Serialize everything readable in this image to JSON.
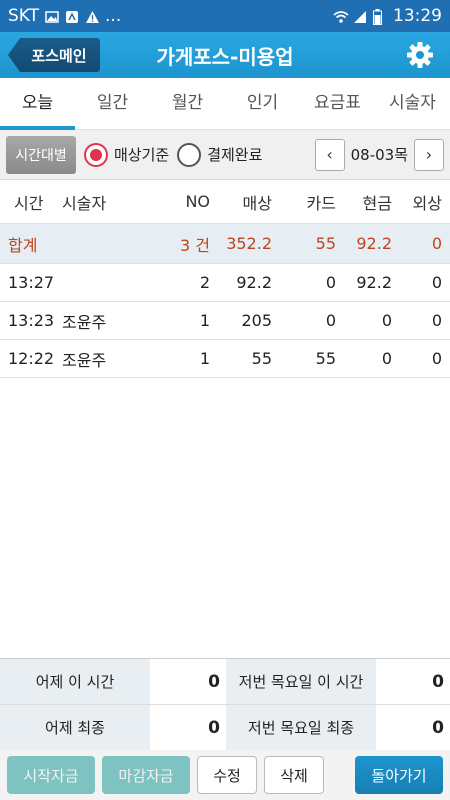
{
  "status": {
    "carrier": "SKT",
    "more": "...",
    "time": "13:29"
  },
  "header": {
    "back_label": "포스메인",
    "title": "가게포스-미용업"
  },
  "tabs": [
    {
      "label": "오늘"
    },
    {
      "label": "일간"
    },
    {
      "label": "월간"
    },
    {
      "label": "인기"
    },
    {
      "label": "요금표"
    },
    {
      "label": "시술자"
    }
  ],
  "filters": {
    "time_button": "시간대별",
    "radio_sales": "매상기준",
    "radio_paid": "결제완료",
    "date": "08-03목",
    "prev": "‹",
    "next": "›"
  },
  "table": {
    "columns": [
      "시간",
      "시술자",
      "NO",
      "매상",
      "카드",
      "현금",
      "외상"
    ],
    "total": {
      "time": "합계",
      "staff": "",
      "no": "3 건",
      "sales": "352.2",
      "card": "55",
      "cash": "92.2",
      "credit": "0"
    },
    "rows": [
      {
        "time": "13:27",
        "staff": "",
        "no": "2",
        "sales": "92.2",
        "card": "0",
        "cash": "92.2",
        "credit": "0"
      },
      {
        "time": "13:23",
        "staff": "조윤주",
        "no": "1",
        "sales": "205",
        "card": "0",
        "cash": "0",
        "credit": "0"
      },
      {
        "time": "12:22",
        "staff": "조윤주",
        "no": "1",
        "sales": "55",
        "card": "55",
        "cash": "0",
        "credit": "0"
      }
    ]
  },
  "summary": {
    "yesterday_now_label": "어제 이 시간",
    "yesterday_now_value": "0",
    "last_thu_now_label": "저번 목요일 이 시간",
    "last_thu_now_value": "0",
    "yesterday_final_label": "어제 최종",
    "yesterday_final_value": "0",
    "last_thu_final_label": "저번 목요일 최종",
    "last_thu_final_value": "0"
  },
  "footer": {
    "start_funds": "시작자금",
    "close_funds": "마감자금",
    "edit": "수정",
    "delete": "삭제",
    "back": "돌아가기"
  },
  "colors": {
    "accent": "#1d95cf",
    "total_text": "#c0441c",
    "radio_checked": "#e0324b"
  }
}
